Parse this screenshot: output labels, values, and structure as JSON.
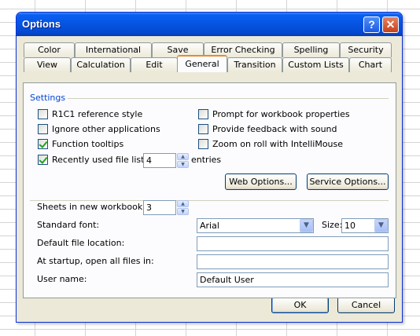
{
  "window": {
    "title": "Options",
    "help_glyph": "?",
    "close_glyph": "✕"
  },
  "tabs_row1": [
    "Color",
    "International",
    "Save",
    "Error Checking",
    "Spelling",
    "Security"
  ],
  "tabs_row2": [
    "View",
    "Calculation",
    "Edit",
    "General",
    "Transition",
    "Custom Lists",
    "Chart"
  ],
  "active_tab": "General",
  "settings": {
    "group_title": "Settings",
    "r1c1": {
      "label": "R1C1 reference style",
      "checked": false
    },
    "ignore_apps": {
      "label": "Ignore other applications",
      "checked": false
    },
    "function_tooltips": {
      "label": "Function tooltips",
      "checked": true
    },
    "recent_files": {
      "label": "Recently used file list:",
      "checked": true,
      "value": "4",
      "suffix": "entries"
    },
    "prompt_props": {
      "label": "Prompt for workbook properties",
      "checked": false
    },
    "feedback_sound": {
      "label": "Provide feedback with sound",
      "checked": false
    },
    "zoom_roll": {
      "label": "Zoom on roll with IntelliMouse",
      "checked": false
    },
    "web_options_label": "Web Options...",
    "service_options_label": "Service Options..."
  },
  "workbook": {
    "sheets_label": "Sheets in new workbook:",
    "sheets_value": "3",
    "font_label": "Standard font:",
    "font_value": "Arial",
    "size_label": "Size:",
    "size_value": "10",
    "default_location_label": "Default file location:",
    "default_location_value": "",
    "startup_label": "At startup, open all files in:",
    "startup_value": "",
    "username_label": "User name:",
    "username_value": "Default User"
  },
  "footer": {
    "ok_label": "OK",
    "cancel_label": "Cancel"
  },
  "colors": {
    "title_bar": "#0654e0",
    "dialog_bg": "#ece9d8",
    "active_tab_accent": "#e68b2c",
    "group_title": "#0046d5"
  }
}
